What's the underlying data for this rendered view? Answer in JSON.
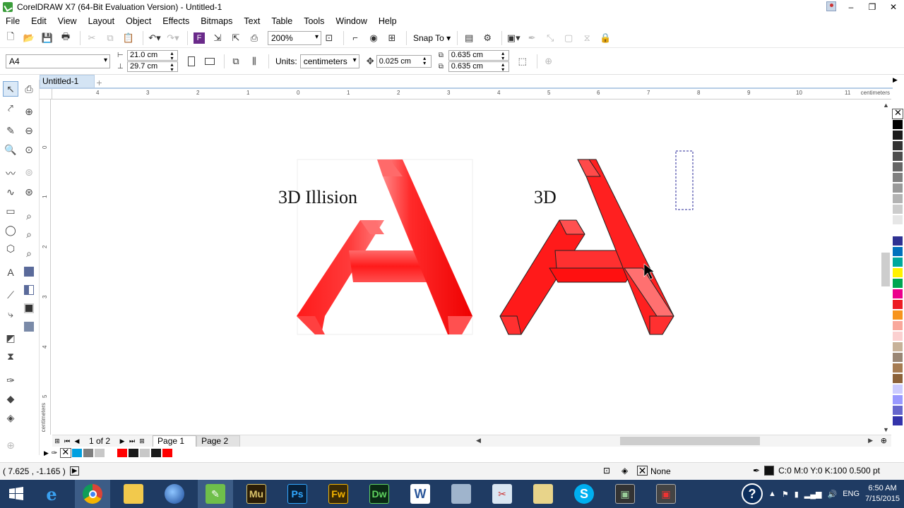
{
  "window": {
    "title": "CorelDRAW X7 (64-Bit Evaluation Version) - Untitled-1",
    "controls": [
      "–",
      "❐",
      "✕"
    ]
  },
  "menu": [
    "File",
    "Edit",
    "View",
    "Layout",
    "Object",
    "Effects",
    "Bitmaps",
    "Text",
    "Table",
    "Tools",
    "Window",
    "Help"
  ],
  "toolbar": {
    "zoom": "200%",
    "snap_to": "Snap To"
  },
  "propertybar": {
    "paper_size": "A4",
    "width": "21.0 cm",
    "height": "29.7 cm",
    "units_label": "Units:",
    "units": "centimeters",
    "nudge": "0.025 cm",
    "dup_x": "0.635 cm",
    "dup_y": "0.635 cm"
  },
  "document_tab": {
    "name": "Untitled-1"
  },
  "ruler": {
    "unit": "centimeters",
    "h_labels": [
      "4",
      "3",
      "2",
      "1",
      "0",
      "1",
      "2",
      "3",
      "4",
      "5",
      "6",
      "7",
      "8",
      "9",
      "10",
      "11"
    ],
    "v_labels": [
      "0",
      "1",
      "2",
      "3",
      "4",
      "5"
    ]
  },
  "canvas": {
    "text_illusion": "3D Illision",
    "text_3d": "3D"
  },
  "pagebar": {
    "count": "1 of 2",
    "pages": [
      "Page 1",
      "Page 2"
    ]
  },
  "palette": {
    "colors": [
      "#000000",
      "#1a1a1a",
      "#333333",
      "#4d4d4d",
      "#666666",
      "#808080",
      "#999999",
      "#b3b3b3",
      "#cccccc",
      "#e6e6e6",
      "#ffffff",
      "#2e3192",
      "#0071bc",
      "#00a99d",
      "#fff200",
      "#00a651",
      "#ec008c",
      "#ed1c24",
      "#f7941d",
      "#f9a89c",
      "#fbd0d0",
      "#c7b299",
      "#998675",
      "#a67c52",
      "#8c6239",
      "#ccccff",
      "#9999ff",
      "#6666cc",
      "#3333aa"
    ],
    "doc_colors": [
      "#00a0e0",
      "#7f7f7f",
      "#c8c8c8",
      "#ffffff",
      "#ff0000",
      "#1a1a1a",
      "#c8c8c8",
      "#1a1a1a",
      "#ff0000"
    ]
  },
  "status": {
    "coords": "( 7.625 , -1.165 )",
    "fill": "None",
    "outline": "C:0 M:0 Y:0 K:100  0.500 pt"
  },
  "taskbar": {
    "apps": [
      "start",
      "ie",
      "chrome",
      "explorer",
      "earth",
      "coreldraw",
      "muse",
      "photoshop",
      "fireworks",
      "dreamweaver",
      "word",
      "calculator",
      "paint",
      "folder",
      "skype",
      "cmd",
      "paint2"
    ],
    "lang": "ENG",
    "time": "6:50 AM",
    "date": "7/15/2015"
  }
}
